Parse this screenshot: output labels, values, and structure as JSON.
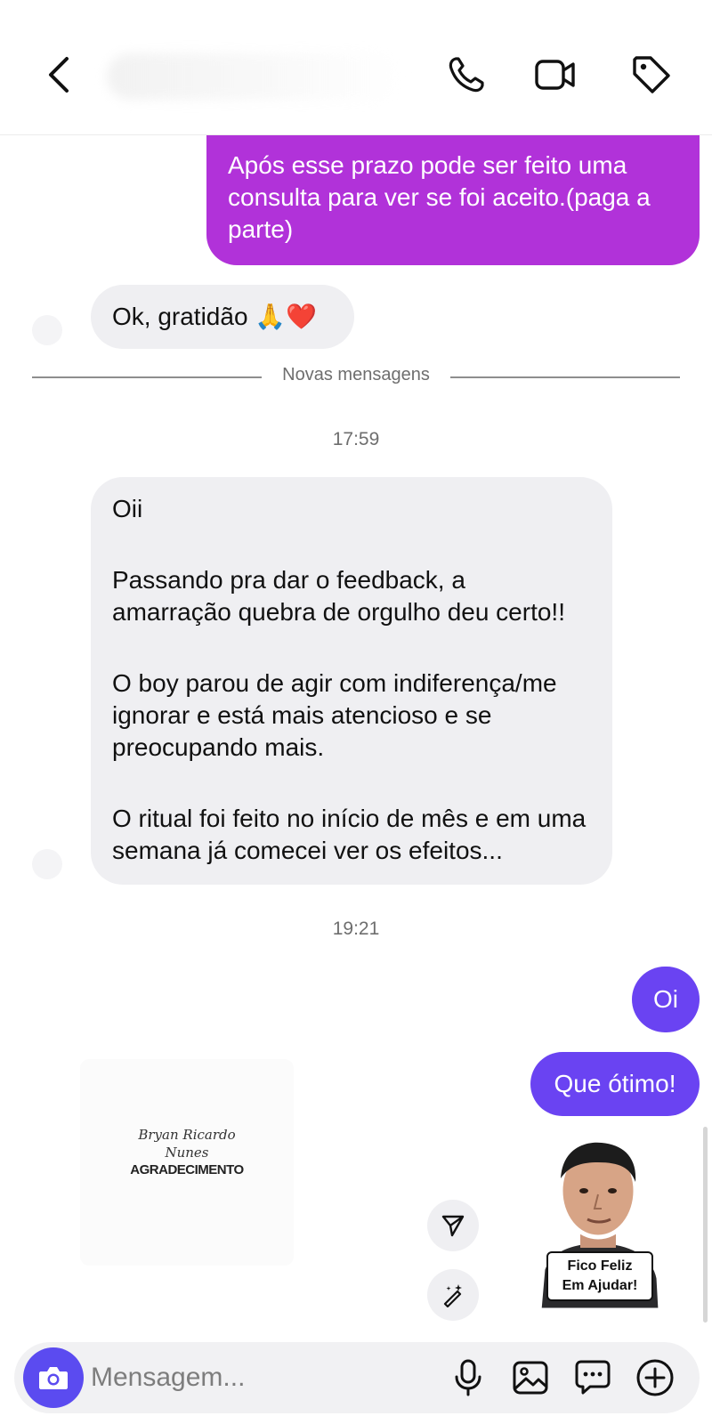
{
  "header": {
    "icons": [
      "chevron-left-icon",
      "phone-icon",
      "video-icon",
      "tag-icon"
    ]
  },
  "messages": {
    "m1": "Após esse prazo pode ser feito uma consulta para ver se foi aceito.(paga a parte)",
    "m2": "Ok, gratidão 🙏❤️",
    "divider": "Novas mensagens",
    "time1": "17:59",
    "m3": {
      "p1": "Oii",
      "p2": "Passando pra dar o feedback, a amarração quebra de orgulho deu certo!!",
      "p3": "O boy parou de agir com indiferença/me ignorar e está mais atencioso e se preocupando mais.",
      "p4": "O ritual foi feito no início de mês e em uma semana já comecei ver os efeitos..."
    },
    "time2": "19:21",
    "m4": "Oi",
    "m5": "Que ótimo!"
  },
  "image_card": {
    "line1": "Bryan Ricardo",
    "line2": "Nunes",
    "line3": "AGRADECIMENTO"
  },
  "sticker": {
    "line1": "Fico Feliz",
    "line2": "Em Ajudar!"
  },
  "composer": {
    "placeholder": "Mensagem..."
  },
  "colors": {
    "sent_purple": "#b132d9",
    "sent_indigo": "#6a43f2",
    "received_bg": "#efeff2",
    "camera_button": "#5b4bf0"
  }
}
